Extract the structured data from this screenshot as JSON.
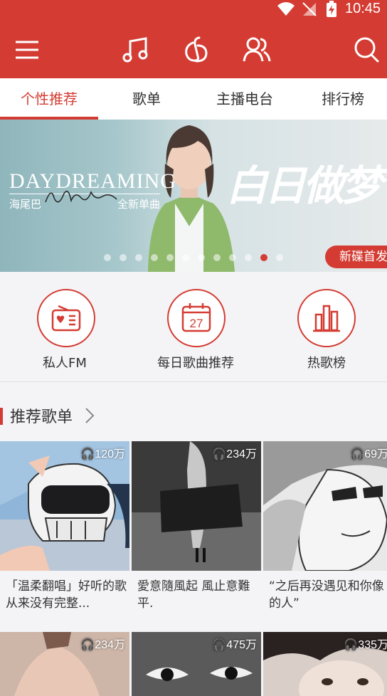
{
  "status": {
    "time": "10:45"
  },
  "tabs": [
    "个性推荐",
    "歌单",
    "主播电台",
    "排行榜"
  ],
  "banner": {
    "title_en": "DAYDREAMING",
    "artist": "海尾巴",
    "subtitle": "全新单曲",
    "calligraphy": "白日做梦",
    "badge": "新碟首发",
    "slide_count": 12,
    "active_slide": 10
  },
  "quick": [
    {
      "label": "私人FM",
      "icon": "radio-icon"
    },
    {
      "label": "每日歌曲推荐",
      "icon": "calendar-icon",
      "date": "27"
    },
    {
      "label": "热歌榜",
      "icon": "chart-bars-icon"
    }
  ],
  "section": {
    "title": "推荐歌单"
  },
  "playlists": [
    {
      "count": "120万",
      "title": "「温柔翻唱」好听的歌从来没有完整..."
    },
    {
      "count": "234万",
      "title": "愛意隨風起 風止意難平."
    },
    {
      "count": "69万",
      "title": "“之后再没遇见和你像的人”"
    },
    {
      "count": "234万",
      "title": ""
    },
    {
      "count": "475万",
      "title": ""
    },
    {
      "count": "335万",
      "title": ""
    }
  ],
  "colors": {
    "brand": "#d43c33"
  }
}
